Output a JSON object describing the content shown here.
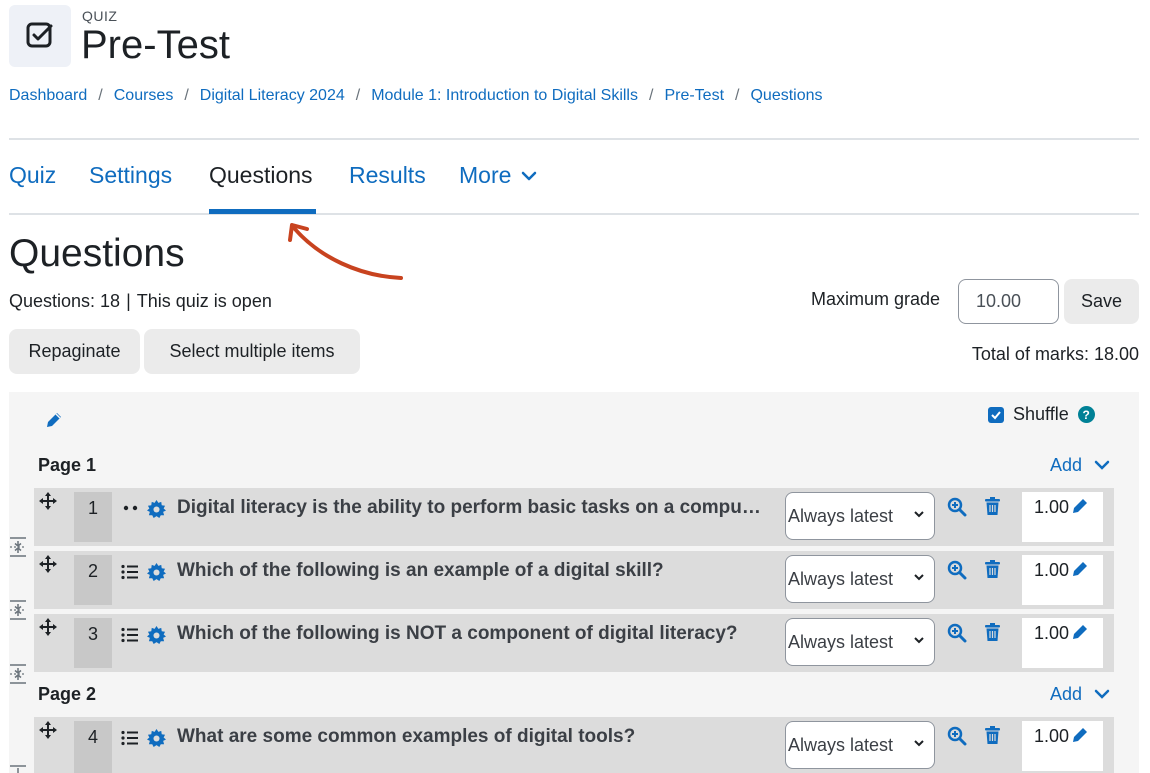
{
  "header": {
    "kicker": "QUIZ",
    "title": "Pre-Test"
  },
  "breadcrumb": [
    "Dashboard",
    "Courses",
    "Digital Literacy 2024",
    "Module 1: Introduction to Digital Skills",
    "Pre-Test",
    "Questions"
  ],
  "tabs": {
    "quiz": "Quiz",
    "settings": "Settings",
    "questions": "Questions",
    "results": "Results",
    "more": "More"
  },
  "page": {
    "heading": "Questions",
    "questions_count": "Questions: 18",
    "status": "This quiz is open",
    "max_grade_label": "Maximum grade",
    "max_grade_value": "10.00",
    "save_label": "Save",
    "repaginate_label": "Repaginate",
    "select_multiple_label": "Select multiple items",
    "total_marks": "Total of marks: 18.00",
    "shuffle_label": "Shuffle",
    "help_symbol": "?"
  },
  "pages": [
    {
      "label": "Page 1",
      "add_label": "Add",
      "questions": [
        {
          "number": "1",
          "type_icon": "true-false-icon",
          "text": "Digital literacy is the ability to perform basic tasks on a compu…",
          "version": "Always latest",
          "mark": "1.00"
        },
        {
          "number": "2",
          "type_icon": "multiple-choice-icon",
          "text": "Which of the following is an example of a digital skill?",
          "version": "Always latest",
          "mark": "1.00"
        },
        {
          "number": "3",
          "type_icon": "multiple-choice-icon",
          "text": "Which of the following is NOT a component of digital literacy?",
          "version": "Always latest",
          "mark": "1.00"
        }
      ]
    },
    {
      "label": "Page 2",
      "add_label": "Add",
      "questions": [
        {
          "number": "4",
          "type_icon": "multiple-choice-icon",
          "text": "What are some common examples of digital tools?",
          "version": "Always latest",
          "mark": "1.00"
        }
      ]
    }
  ],
  "colors": {
    "link": "#0f6cbf",
    "arrow": "#c8431f",
    "help": "#008196"
  }
}
